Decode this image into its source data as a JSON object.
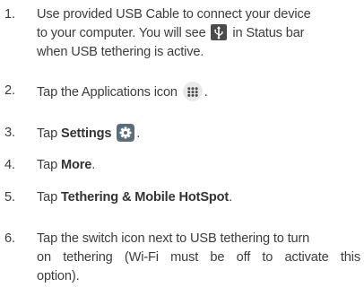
{
  "steps": [
    {
      "num": "1.",
      "line1": "Use provided USB Cable to connect your device",
      "line2a": "to your computer. You will see",
      "line2b": "in Status bar",
      "line3": "when USB tethering is active."
    },
    {
      "num": "2.",
      "text": "Tap the Applications icon",
      "tail": "."
    },
    {
      "num": "3.",
      "pre": "Tap ",
      "bold": "Settings",
      "tail": "."
    },
    {
      "num": "4.",
      "pre": "Tap ",
      "bold": "More",
      "tail": "."
    },
    {
      "num": "5.",
      "pre": "Tap ",
      "bold": "Tethering & Mobile HotSpot",
      "tail": "."
    },
    {
      "num": "6.",
      "line1": "Tap the switch icon next to USB tethering to turn",
      "line2": "on tethering (Wi-Fi must be off to activate this",
      "line3": "option)."
    }
  ],
  "icons": {
    "usb": "usb-tethering-icon",
    "apps": "applications-icon",
    "settings": "settings-gear-icon"
  },
  "colors": {
    "text": "#3c3c3c",
    "icon_dark": "#4a4a4a",
    "icon_light": "#eeeeee",
    "settings_bg": "#5a6e7c"
  }
}
